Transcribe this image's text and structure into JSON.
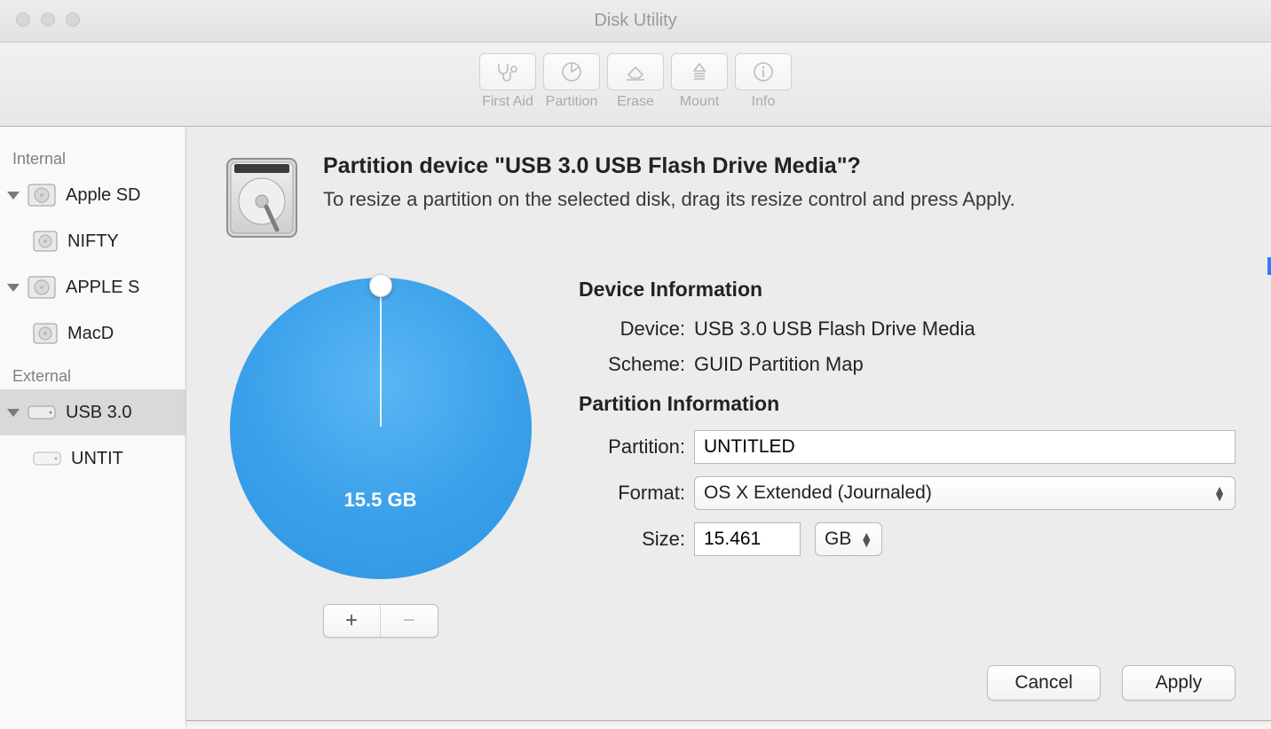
{
  "window": {
    "title": "Disk Utility"
  },
  "toolbar": {
    "first_aid": "First Aid",
    "partition": "Partition",
    "erase": "Erase",
    "mount": "Mount",
    "info": "Info"
  },
  "sidebar": {
    "internal_heading": "Internal",
    "external_heading": "External",
    "internal": [
      {
        "name": "Apple SD",
        "children": [
          {
            "name": "NIFTY"
          }
        ]
      },
      {
        "name": "APPLE S",
        "children": [
          {
            "name": "MacD"
          }
        ]
      }
    ],
    "external": [
      {
        "name": "USB 3.0",
        "children": [
          {
            "name": "UNTIT"
          }
        ]
      }
    ]
  },
  "sheet": {
    "title": "Partition device \"USB 3.0 USB Flash Drive Media\"?",
    "subtitle": "To resize a partition on the selected disk, drag its resize control and press Apply.",
    "pie_label": "15.5 GB",
    "add_symbol": "+",
    "remove_symbol": "−",
    "device_info_heading": "Device Information",
    "device_label": "Device:",
    "device_value": "USB 3.0 USB Flash Drive Media",
    "scheme_label": "Scheme:",
    "scheme_value": "GUID Partition Map",
    "partition_info_heading": "Partition Information",
    "partition_label": "Partition:",
    "partition_value": "UNTITLED",
    "format_label": "Format:",
    "format_value": "OS X Extended (Journaled)",
    "size_label": "Size:",
    "size_value": "15.461",
    "size_unit": "GB",
    "cancel": "Cancel",
    "apply": "Apply"
  }
}
